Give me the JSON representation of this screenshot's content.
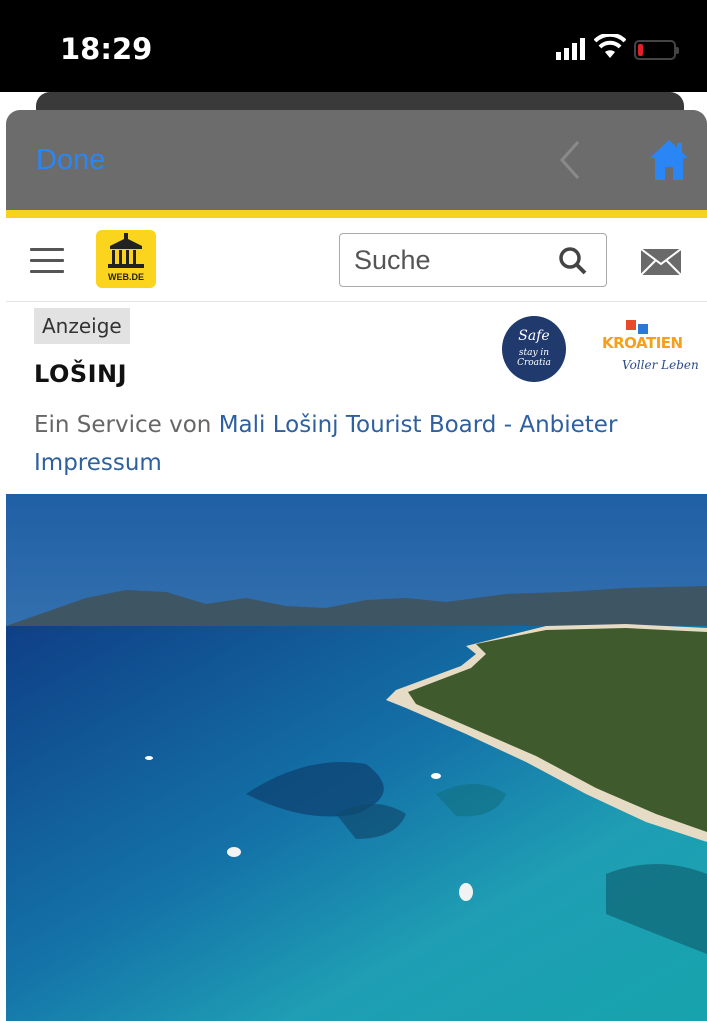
{
  "status_bar": {
    "time": "18:29"
  },
  "browser": {
    "done_label": "Done"
  },
  "header": {
    "logo_text": "WEB.DE",
    "search_placeholder": "Suche"
  },
  "ad": {
    "badge": "Anzeige",
    "title": "LOŠINJ",
    "service_prefix": "Ein Service von ",
    "service_link": "Mali Lošinj Tourist Board - Anbieter",
    "impressum": "Impressum",
    "safe_badge_title": "Safe",
    "safe_badge_sub": "stay in Croatia",
    "kroatien_logo": "KROATIEN",
    "kroatien_tagline": "Voller Leben"
  },
  "colors": {
    "accent_blue": "#2a86f5",
    "brand_yellow": "#f8d21e",
    "link_blue": "#2e5f9e"
  },
  "icons": [
    "signal-icon",
    "wifi-icon",
    "battery-icon",
    "back-chevron-icon",
    "home-icon",
    "hamburger-menu-icon",
    "search-icon",
    "mail-icon"
  ]
}
